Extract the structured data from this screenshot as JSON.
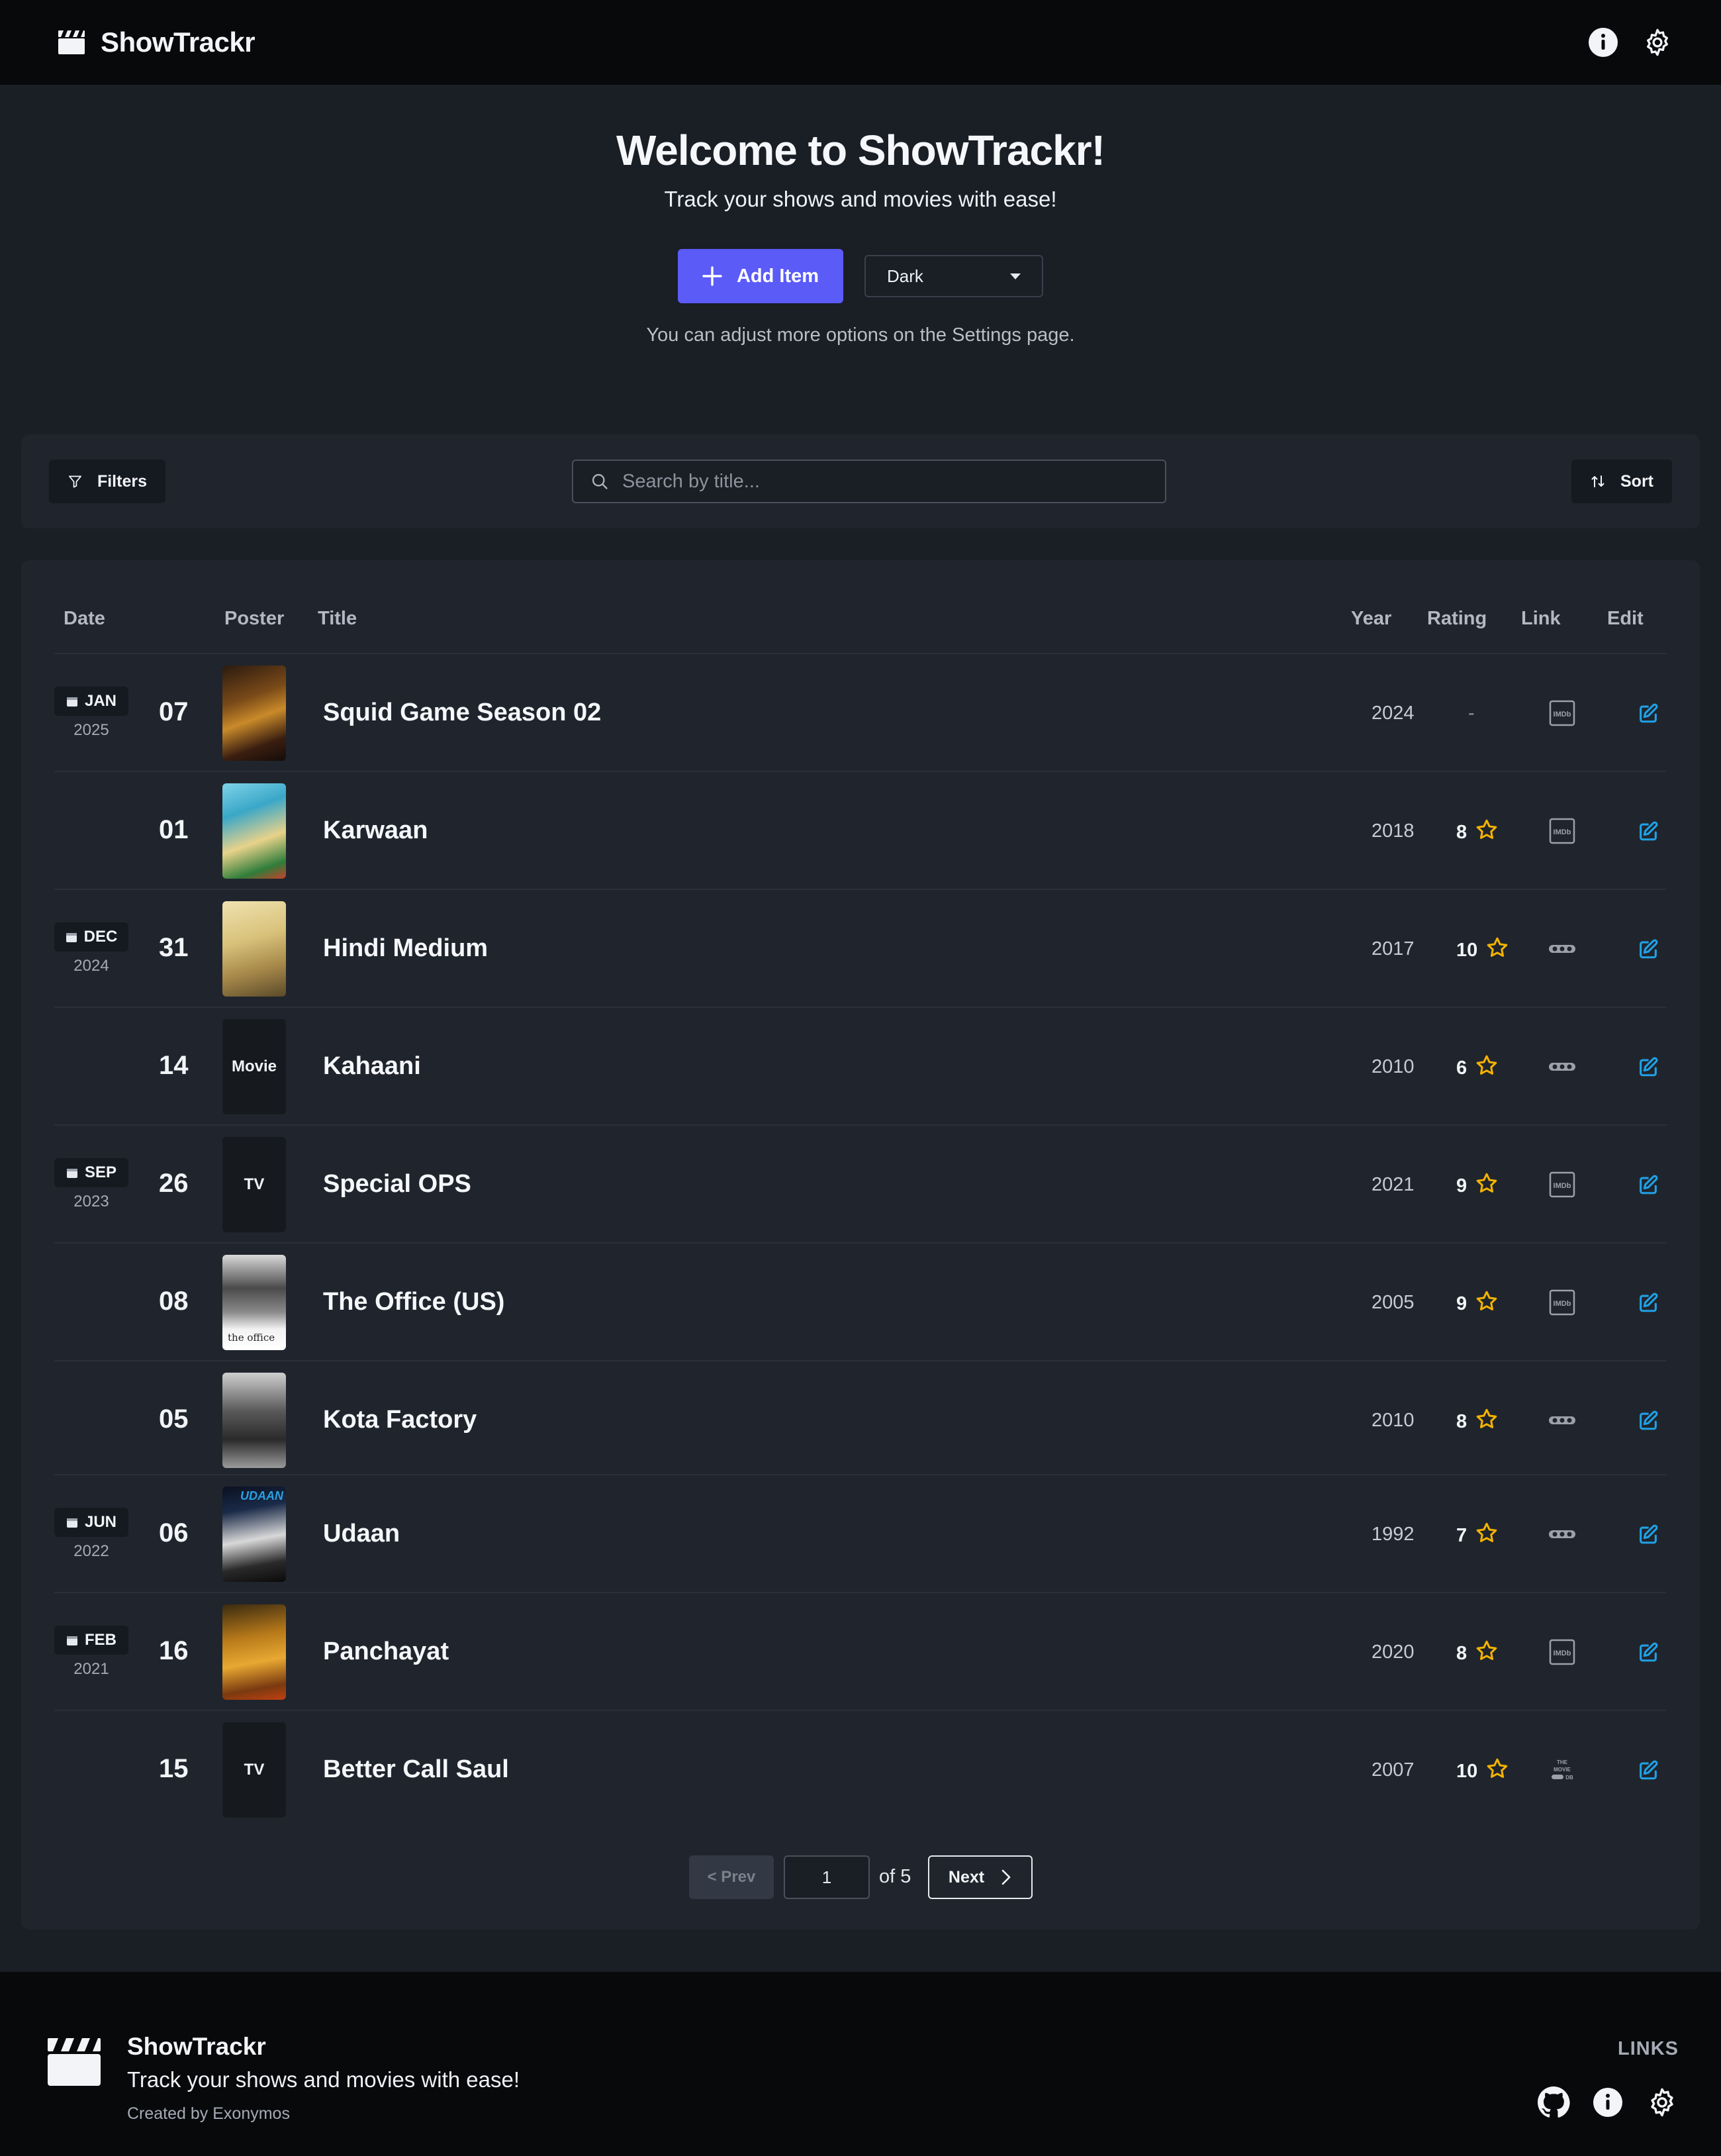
{
  "app": {
    "name": "ShowTrackr",
    "nav": {
      "info_icon": "info-circle-icon",
      "settings_icon": "gear-icon"
    }
  },
  "hero": {
    "title": "Welcome to ShowTrackr!",
    "subtitle": "Track your shows and movies with ease!",
    "add_button": "Add Item",
    "theme_select": "Dark",
    "note": "You can adjust more options on the Settings page."
  },
  "filters": {
    "filters_button": "Filters",
    "search_placeholder": "Search by title...",
    "sort_button": "Sort"
  },
  "table": {
    "headers": {
      "date": "Date",
      "poster": "Poster",
      "title": "Title",
      "year": "Year",
      "rating": "Rating",
      "link": "Link",
      "edit": "Edit"
    },
    "rows": [
      {
        "month": "JAN",
        "year_group": "2025",
        "day": "07",
        "poster": "image",
        "poster_text": "",
        "title": "Squid Game Season 02",
        "year": "2024",
        "rating": "-",
        "link": "IMDb"
      },
      {
        "month": "",
        "year_group": "",
        "day": "01",
        "poster": "image",
        "poster_text": "",
        "title": "Karwaan",
        "year": "2018",
        "rating": "8",
        "link": "IMDb"
      },
      {
        "month": "DEC",
        "year_group": "2024",
        "day": "31",
        "poster": "image",
        "poster_text": "",
        "title": "Hindi Medium",
        "year": "2017",
        "rating": "10",
        "link": "dots"
      },
      {
        "month": "",
        "year_group": "",
        "day": "14",
        "poster": "placeholder",
        "poster_text": "Movie",
        "title": "Kahaani",
        "year": "2010",
        "rating": "6",
        "link": "dots"
      },
      {
        "month": "SEP",
        "year_group": "2023",
        "day": "26",
        "poster": "placeholder",
        "poster_text": "TV",
        "title": "Special OPS",
        "year": "2021",
        "rating": "9",
        "link": "IMDb"
      },
      {
        "month": "",
        "year_group": "",
        "day": "08",
        "poster": "image",
        "poster_text": "the office",
        "title": "The Office (US)",
        "year": "2005",
        "rating": "9",
        "link": "IMDb"
      },
      {
        "month": "",
        "year_group": "",
        "day": "05",
        "poster": "image",
        "poster_text": "",
        "title": "Kota Factory",
        "year": "2010",
        "rating": "8",
        "link": "dots"
      },
      {
        "month": "JUN",
        "year_group": "2022",
        "day": "06",
        "poster": "image",
        "poster_text": "UDAAN",
        "title": "Udaan",
        "year": "1992",
        "rating": "7",
        "link": "dots"
      },
      {
        "month": "FEB",
        "year_group": "2021",
        "day": "16",
        "poster": "image",
        "poster_text": "",
        "title": "Panchayat",
        "year": "2020",
        "rating": "8",
        "link": "IMDb"
      },
      {
        "month": "",
        "year_group": "",
        "day": "15",
        "poster": "placeholder",
        "poster_text": "TV",
        "title": "Better Call Saul",
        "year": "2007",
        "rating": "10",
        "link": "TMDB"
      }
    ]
  },
  "pagination": {
    "prev": "< Prev",
    "page": "1",
    "of": "of 5",
    "next": "Next"
  },
  "footer": {
    "name": "ShowTrackr",
    "tagline": "Track your shows and movies with ease!",
    "credit": "Created by Exonymos",
    "links_label": "LINKS",
    "icons": [
      "github-icon",
      "info-circle-icon",
      "gear-icon"
    ]
  },
  "colors": {
    "background": "#1a1e25",
    "surface": "#20252d",
    "nav": "#08090b",
    "accent": "#5b5bf7",
    "star": "#f5b301",
    "edit": "#1fa2e8"
  }
}
